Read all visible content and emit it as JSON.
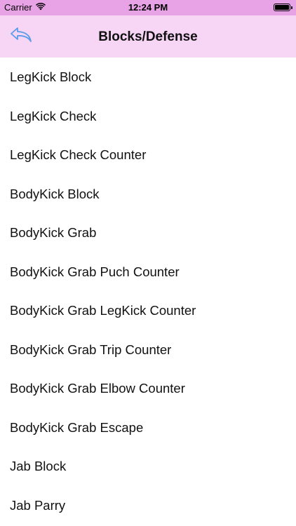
{
  "status_bar": {
    "carrier": "Carrier",
    "time": "12:24 PM",
    "wifi_icon": "wifi-icon",
    "battery_icon": "battery-icon",
    "battery_level": 1.0
  },
  "nav": {
    "title": "Blocks/Defense",
    "back_icon": "reply-arrow-icon",
    "accent_color": "#5a9bea",
    "background_color": "#f6d5f5",
    "status_bar_color": "#e8a2e6"
  },
  "items": [
    {
      "label": "LegKick Block"
    },
    {
      "label": "LegKick Check"
    },
    {
      "label": "LegKick Check Counter"
    },
    {
      "label": "BodyKick Block"
    },
    {
      "label": "BodyKick Grab"
    },
    {
      "label": "BodyKick Grab Puch Counter"
    },
    {
      "label": "BodyKick Grab LegKick Counter"
    },
    {
      "label": "BodyKick Grab Trip Counter"
    },
    {
      "label": "BodyKick Grab Elbow Counter"
    },
    {
      "label": "BodyKick Grab Escape"
    },
    {
      "label": "Jab Block"
    },
    {
      "label": "Jab Parry"
    }
  ]
}
